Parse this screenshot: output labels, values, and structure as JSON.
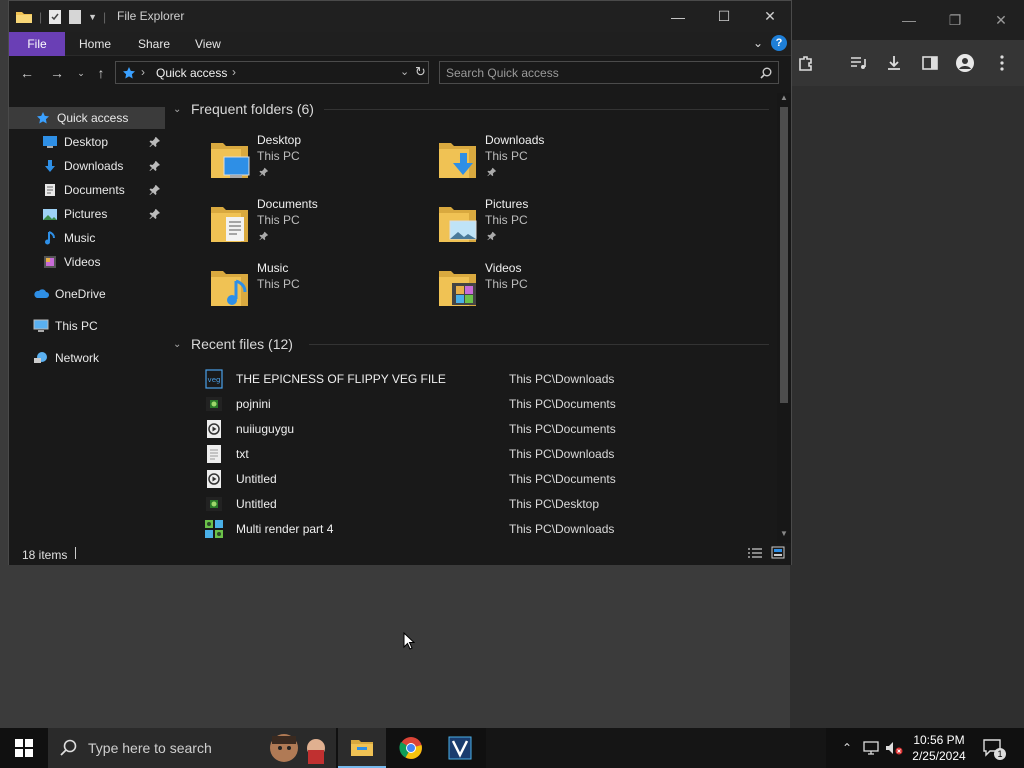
{
  "window": {
    "title": "File Explorer"
  },
  "ribbon": {
    "tabs": [
      "File",
      "Home",
      "Share",
      "View"
    ]
  },
  "nav": {
    "address": "Quick access",
    "search_placeholder": "Search Quick access"
  },
  "sidebar": {
    "items": [
      {
        "label": "Quick access",
        "icon": "star-icon"
      },
      {
        "label": "Desktop",
        "icon": "desktop-icon",
        "pinned": true
      },
      {
        "label": "Downloads",
        "icon": "download-arrow-icon",
        "pinned": true
      },
      {
        "label": "Documents",
        "icon": "document-icon",
        "pinned": true
      },
      {
        "label": "Pictures",
        "icon": "picture-icon",
        "pinned": true
      },
      {
        "label": "Music",
        "icon": "music-note-icon"
      },
      {
        "label": "Videos",
        "icon": "film-icon"
      },
      {
        "label": "OneDrive",
        "icon": "cloud-icon"
      },
      {
        "label": "This PC",
        "icon": "monitor-icon"
      },
      {
        "label": "Network",
        "icon": "network-icon"
      }
    ]
  },
  "frequent": {
    "header": "Frequent folders (6)",
    "folders": [
      {
        "name": "Desktop",
        "location": "This PC",
        "pinned": true
      },
      {
        "name": "Downloads",
        "location": "This PC",
        "pinned": true
      },
      {
        "name": "Documents",
        "location": "This PC",
        "pinned": true
      },
      {
        "name": "Pictures",
        "location": "This PC",
        "pinned": true
      },
      {
        "name": "Music",
        "location": "This PC",
        "pinned": false
      },
      {
        "name": "Videos",
        "location": "This PC",
        "pinned": false
      }
    ]
  },
  "recent": {
    "header": "Recent files (12)",
    "files": [
      {
        "name": "THE EPICNESS OF FLIPPY VEG FILE",
        "location": "This PC\\Downloads",
        "icon": "veg-file-icon"
      },
      {
        "name": "pojnini",
        "location": "This PC\\Documents",
        "icon": "image-file-icon"
      },
      {
        "name": "nuiiuguygu",
        "location": "This PC\\Documents",
        "icon": "media-file-icon"
      },
      {
        "name": "txt",
        "location": "This PC\\Downloads",
        "icon": "text-file-icon"
      },
      {
        "name": "Untitled",
        "location": "This PC\\Documents",
        "icon": "media-file-icon"
      },
      {
        "name": "Untitled",
        "location": "This PC\\Desktop",
        "icon": "image-file-icon"
      },
      {
        "name": "Multi render part 4",
        "location": "This PC\\Downloads",
        "icon": "render-file-icon"
      }
    ]
  },
  "status": {
    "items": "18 items"
  },
  "taskbar": {
    "search_placeholder": "Type here to search",
    "time": "10:56 PM",
    "date": "2/25/2024",
    "notification_count": "1"
  },
  "colors": {
    "accent": "#6a3fb5",
    "folder": "#f0c254",
    "taskbar": "#101010"
  }
}
